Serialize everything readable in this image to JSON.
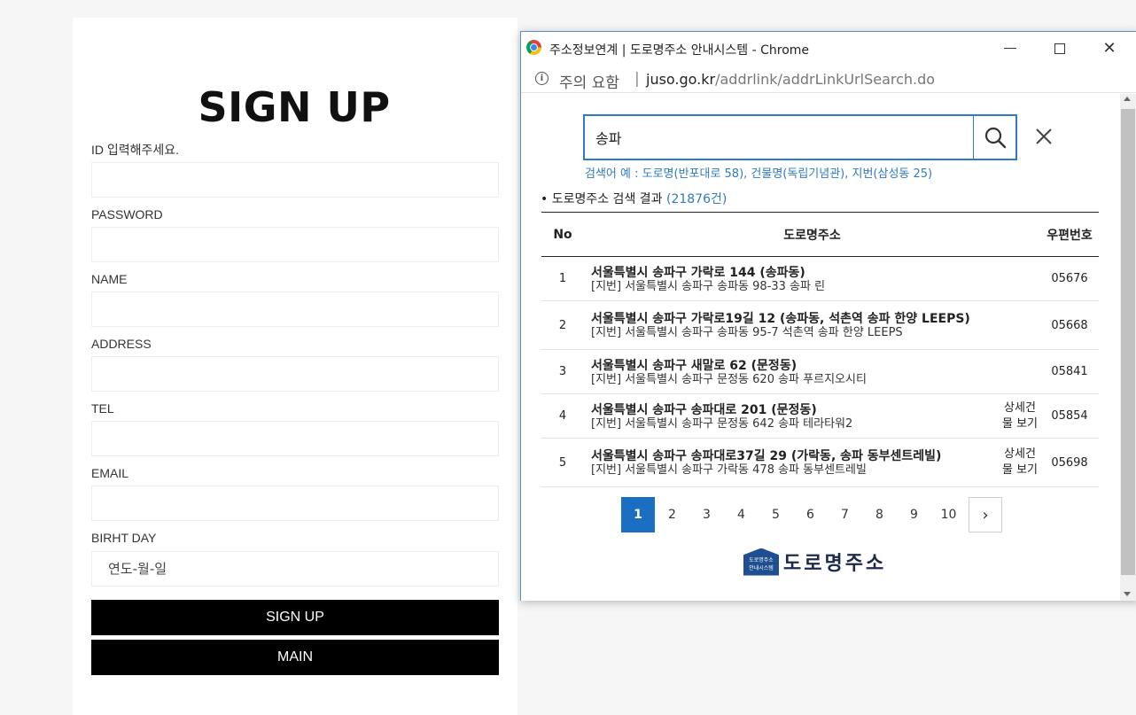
{
  "signup": {
    "title": "SIGN UP",
    "id_label": "ID 입력해주세요.",
    "password_label": "PASSWORD",
    "name_label": "NAME",
    "address_label": "ADDRESS",
    "tel_label": "TEL",
    "email_label": "EMAIL",
    "birthday_label": "BIRHT DAY",
    "birthday_placeholder": "연도-월-일",
    "signup_button": "SIGN UP",
    "main_button": "MAIN"
  },
  "popup": {
    "window_title": "주소정보연계 | 도로명주소 안내시스템 - Chrome",
    "minimize": "—",
    "close": "✕",
    "security_text": "주의 요함",
    "url_divider": "|",
    "url_host": "juso.go.kr",
    "url_path": "/addrlink/addrLinkUrlSearch.do",
    "search_value": "송파",
    "search_hint": "검색어 예 : 도로명(반포대로 58), 건물명(독립기념관), 지번(삼성동 25)",
    "result_prefix": "• 도로명주소 검색 결과 ",
    "result_count": "(21876건)",
    "table_headers": {
      "no": "No",
      "address": "도로명주소",
      "zip": "우편번호"
    },
    "rows": [
      {
        "no": "1",
        "road": "서울특별시 송파구 가락로 144 (송파동)",
        "jibun": "[지번] 서울특별시 송파구 송파동 98-33 송파 린",
        "detail": "",
        "zip": "05676"
      },
      {
        "no": "2",
        "road": "서울특별시 송파구 가락로19길 12 (송파동, 석촌역 송파 한양 LEEPS)",
        "jibun": "[지번] 서울특별시 송파구 송파동 95-7 석촌역 송파 한양 LEEPS",
        "detail": "",
        "zip": "05668"
      },
      {
        "no": "3",
        "road": "서울특별시 송파구 새말로 62 (문정동)",
        "jibun": "[지번] 서울특별시 송파구 문정동 620 송파 푸르지오시티",
        "detail": "",
        "zip": "05841"
      },
      {
        "no": "4",
        "road": "서울특별시 송파구 송파대로 201 (문정동)",
        "jibun": "[지번] 서울특별시 송파구 문정동 642 송파 테라타워2",
        "detail": "상세건물 보기",
        "zip": "05854"
      },
      {
        "no": "5",
        "road": "서울특별시 송파구 송파대로37길 29 (가락동, 송파 동부센트레빌)",
        "jibun": "[지번] 서울특별시 송파구 가락동 478 송파 동부센트레빌",
        "detail": "상세건물 보기",
        "zip": "05698"
      }
    ],
    "pages": [
      "1",
      "2",
      "3",
      "4",
      "5",
      "6",
      "7",
      "8",
      "9",
      "10"
    ],
    "current_page": "1",
    "next_label": "›",
    "logo_emblem_line1": "도로명주소",
    "logo_emblem_line2": "안내시스템",
    "logo_text": "도로명주소"
  },
  "colors": {
    "accent": "#2f7bc2",
    "active_page": "#1a6fc2",
    "button_black": "#000000"
  },
  "icons": [
    "info-icon",
    "search-icon",
    "clear-icon",
    "chevron-right-icon",
    "chrome-logo-icon",
    "minimize-icon",
    "maximize-icon",
    "close-icon"
  ]
}
